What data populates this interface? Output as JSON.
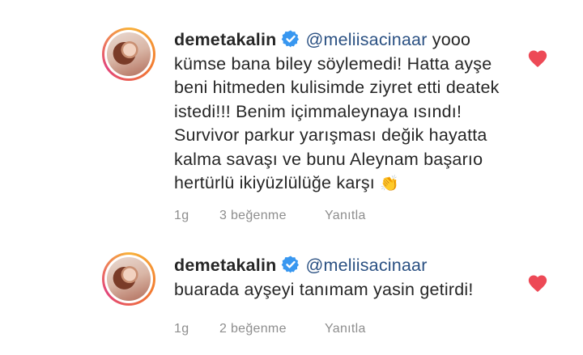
{
  "comments": [
    {
      "username": "demetakalin",
      "mention": "@meliisacinaar",
      "text": "yooo kümse bana biley söylemedi! Hatta ayşe beni hitmeden kulisimde ziyret etti deatek istedi!!! Benim içimmaleynaya ısındı! Survivor parkur yarışması değik hayatta kalma savaşı ve bunu Aleynam başarıo hertürlü ikiyüzlülüğe karşı",
      "emoji": "👏",
      "emoji_name": "clapping-hands-icon",
      "time": "1g",
      "likes": "3 beğenme",
      "reply": "Yanıtla",
      "liked": true
    },
    {
      "username": "demetakalin",
      "mention": "@meliisacinaar",
      "text": "buarada ayşeyi tanımam yasin getirdi!",
      "emoji": "",
      "emoji_name": "",
      "time": "1g",
      "likes": "2 beğenme",
      "reply": "Yanıtla",
      "liked": true
    }
  ],
  "colors": {
    "mention": "#2a5082",
    "verified": "#3897f0",
    "heart": "#ed4956",
    "meta_text": "#8e8e8e"
  },
  "icons": [
    "verified-badge-icon",
    "heart-icon",
    "clapping-hands-icon"
  ]
}
